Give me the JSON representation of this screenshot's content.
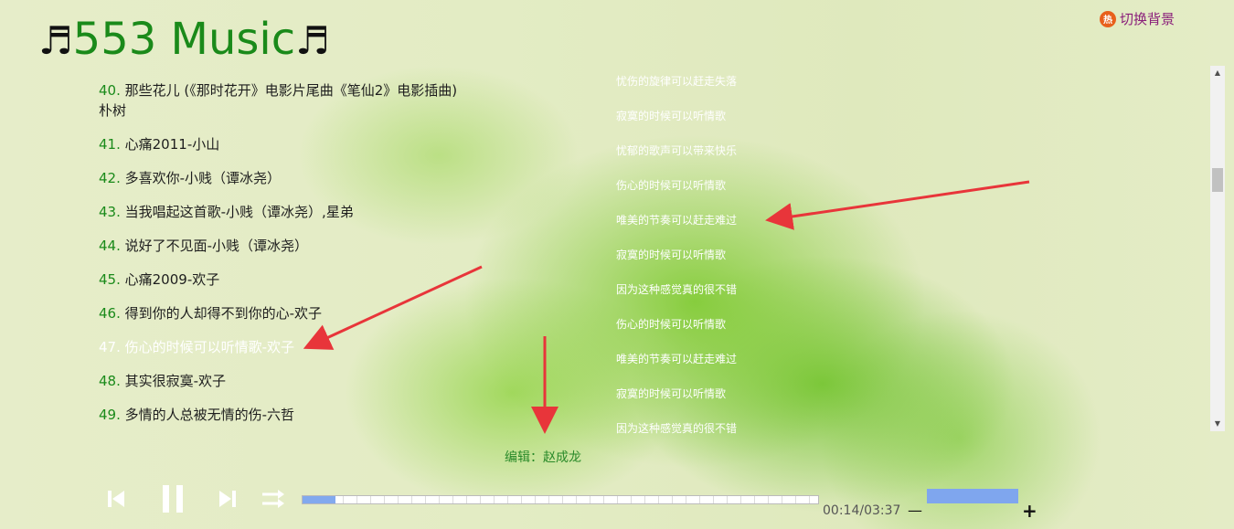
{
  "header": {
    "note_left": "♬",
    "title": "553 Music",
    "note_right": "♬",
    "switch_bg_icon_text": "热",
    "switch_bg_label": "切换背景"
  },
  "songs": [
    {
      "num": "40.",
      "title": "那些花儿 (《那时花开》电影片尾曲《笔仙2》电影插曲)",
      "artist": "朴树"
    },
    {
      "num": "41.",
      "title": "心痛2011-小山"
    },
    {
      "num": "42.",
      "title": "多喜欢你-小贱（谭冰尧）"
    },
    {
      "num": "43.",
      "title": "当我唱起这首歌-小贱（谭冰尧）,星弟"
    },
    {
      "num": "44.",
      "title": "说好了不见面-小贱（谭冰尧）"
    },
    {
      "num": "45.",
      "title": "心痛2009-欢子"
    },
    {
      "num": "46.",
      "title": "得到你的人却得不到你的心-欢子"
    },
    {
      "num": "47.",
      "title": "伤心的时候可以听情歌-欢子"
    },
    {
      "num": "48.",
      "title": "其实很寂寞-欢子"
    },
    {
      "num": "49.",
      "title": "多情的人总被无情的伤-六哲"
    }
  ],
  "active_song_index": 7,
  "lyrics": [
    "忧伤的旋律可以赶走失落",
    "寂寞的时候可以听情歌",
    "忧郁的歌声可以带来快乐",
    "伤心的时候可以听情歌",
    "唯美的节奏可以赶走难过",
    "寂寞的时候可以听情歌",
    "因为这种感觉真的很不错",
    "伤心的时候可以听情歌",
    "唯美的节奏可以赶走难过",
    "寂寞的时候可以听情歌",
    "因为这种感觉真的很不错"
  ],
  "editor": "编辑：赵成龙",
  "player": {
    "time": "00:14/03:37",
    "progress": 0.064,
    "volume_minus": "—",
    "volume_plus": "+",
    "volume_level": 1.0
  },
  "colors": {
    "accent_green": "#1a8a1a",
    "progress_blue": "#82a9ee",
    "arrow_red": "#e8353a"
  }
}
